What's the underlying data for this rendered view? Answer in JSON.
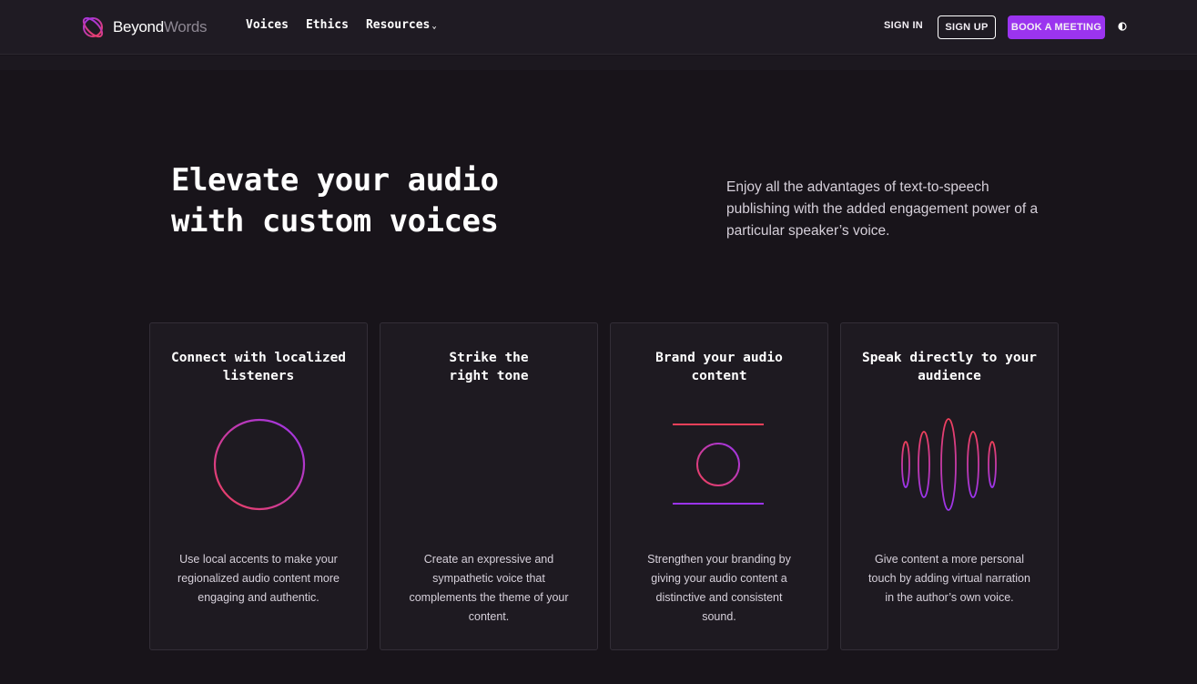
{
  "brand": {
    "name_part1": "Beyond",
    "name_part2": "Words",
    "accent": "#9b34ef",
    "gradient_start": "#f0405a",
    "gradient_end": "#9b34ef"
  },
  "nav": {
    "items": [
      {
        "label": "Voices"
      },
      {
        "label": "Ethics"
      },
      {
        "label": "Resources",
        "has_dropdown": true
      }
    ],
    "sign_in": "SIGN IN",
    "sign_up": "SIGN UP",
    "book_meeting": "BOOK A MEETING",
    "theme_toggle_icon": "half-circle-icon"
  },
  "hero": {
    "title_line1": "Elevate your audio",
    "title_line2": "with custom voices",
    "description": "Enjoy all the advantages of text-to-speech publishing with the added engagement power of a particular speaker’s voice."
  },
  "features": [
    {
      "title_line1": "Connect with localized",
      "title_line2": "listeners",
      "icon": "circle-icon",
      "description": "Use local accents to make your regionalized audio content more engaging and authentic."
    },
    {
      "title_line1": "Strike the",
      "title_line2": "right tone",
      "icon": "cross-icon",
      "description": "Create an expressive and sympathetic voice that complements the theme of your content."
    },
    {
      "title_line1": "Brand your audio",
      "title_line2": "content",
      "icon": "framed-circle-icon",
      "description": "Strengthen your branding by giving your audio content a distinctive and consistent sound."
    },
    {
      "title_line1": "Speak directly to your",
      "title_line2": "audience",
      "icon": "waveform-icon",
      "description": "Give content a more personal touch by adding virtual narration in the author’s own voice."
    }
  ]
}
